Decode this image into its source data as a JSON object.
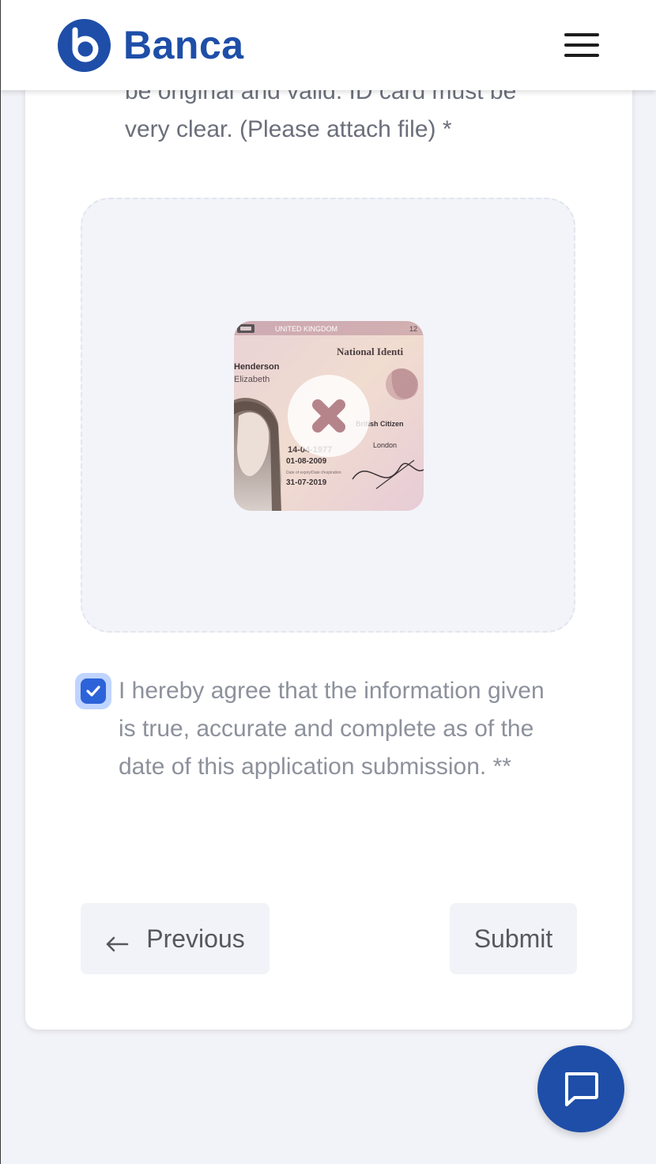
{
  "header": {
    "brand": "Banca",
    "menu_icon": "hamburger-menu-icon"
  },
  "form": {
    "instruction": "be original and valid. ID card must be very clear. (Please attach file) *",
    "upload": {
      "id_card": {
        "header_text": "UNITED KINGDOM",
        "title": "National Identi",
        "number": "12",
        "surname": "Henderson",
        "given_name": "Elizabeth",
        "nationality": "British Citizen",
        "birth_date": "14-04-1977",
        "place": "London",
        "issue_date": "01-08-2009",
        "expiry_label": "Date of expiry/Date d'expiration",
        "expiry_date": "31-07-2019"
      },
      "remove_icon": "close-x-icon"
    },
    "agreement": {
      "checked": true,
      "text": "I hereby agree that the information given is true, accurate and complete as of the date of this application submission. **"
    },
    "buttons": {
      "previous": "Previous",
      "submit": "Submit"
    }
  },
  "chat": {
    "icon": "chat-bubble-icon"
  },
  "colors": {
    "brand": "#1e4ea8",
    "checkbox": "#2c63d8",
    "page_bg": "#f2f3f8"
  }
}
